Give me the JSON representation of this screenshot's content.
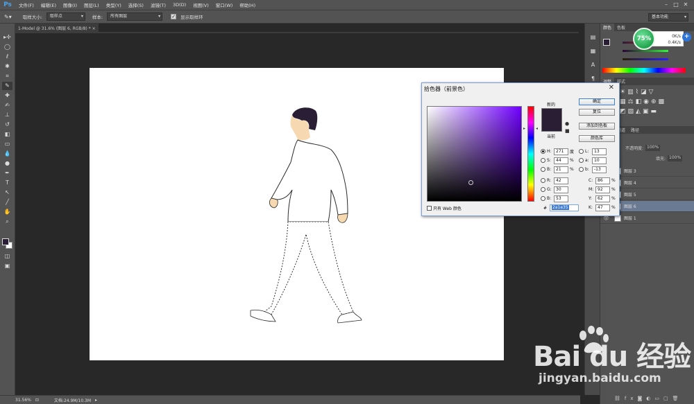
{
  "app": {
    "logo": "Ps"
  },
  "menu": [
    "文件(F)",
    "编辑(E)",
    "图像(I)",
    "图层(L)",
    "类型(Y)",
    "选择(S)",
    "滤镜(T)",
    "3D(D)",
    "视图(V)",
    "窗口(W)",
    "帮助(H)"
  ],
  "options": {
    "sample_size_label": "取样大小:",
    "sample_size_value": "取样点",
    "sample_label": "样本:",
    "sample_value": "所有图层",
    "show_ring_label": "显示取样环",
    "workspace": "基本功能"
  },
  "document": {
    "tab_title": "1-Model @ 31.6% (图层 6, RGB/8) *"
  },
  "status": {
    "zoom": "31.56%",
    "doc_size": "文档:24.9M/10.3M"
  },
  "panels": {
    "color_tabs": [
      "颜色",
      "色板"
    ],
    "adjust_tabs": [
      "调整",
      "样式"
    ],
    "layer_tabs": [
      "图层",
      "通道",
      "路径"
    ],
    "opacity_label": "不透明度:",
    "opacity_value": "100%",
    "fill_label": "填充:",
    "fill_value": "100%",
    "layers": [
      {
        "name": "图层 3",
        "selected": false
      },
      {
        "name": "图层 4",
        "selected": false
      },
      {
        "name": "图层 5",
        "selected": false
      },
      {
        "name": "图层 6",
        "selected": true
      },
      {
        "name": "图层 1",
        "selected": false
      }
    ]
  },
  "speed": {
    "percent": "75%",
    "up": "0K/s",
    "down": "0.4K/s"
  },
  "picker": {
    "title": "拾色器（前景色）",
    "new_label": "新的",
    "current_label": "当前",
    "buttons": {
      "ok": "确定",
      "reset": "复位",
      "add_swatch": "添加到色板",
      "libraries": "颜色库"
    },
    "hsb": [
      {
        "label": "H:",
        "value": "271",
        "unit": "度",
        "selected": true
      },
      {
        "label": "S:",
        "value": "44",
        "unit": "%",
        "selected": false
      },
      {
        "label": "B:",
        "value": "21",
        "unit": "%",
        "selected": false
      }
    ],
    "rgb": [
      {
        "label": "R:",
        "value": "42"
      },
      {
        "label": "G:",
        "value": "30"
      },
      {
        "label": "B:",
        "value": "53"
      }
    ],
    "lab": [
      {
        "label": "L:",
        "value": "13"
      },
      {
        "label": "a:",
        "value": "10"
      },
      {
        "label": "b:",
        "value": "-13"
      }
    ],
    "cmyk": [
      {
        "label": "C:",
        "value": "86",
        "unit": "%"
      },
      {
        "label": "M:",
        "value": "92",
        "unit": "%"
      },
      {
        "label": "Y:",
        "value": "62",
        "unit": "%"
      },
      {
        "label": "K:",
        "value": "47",
        "unit": "%"
      }
    ],
    "hex_label": "#",
    "hex": "2a1e35",
    "web_only": "只有 Web 颜色",
    "color": "#2a1e35"
  },
  "watermark": {
    "logo": "Bai du 经验",
    "url": "jingyan.baidu.com"
  }
}
